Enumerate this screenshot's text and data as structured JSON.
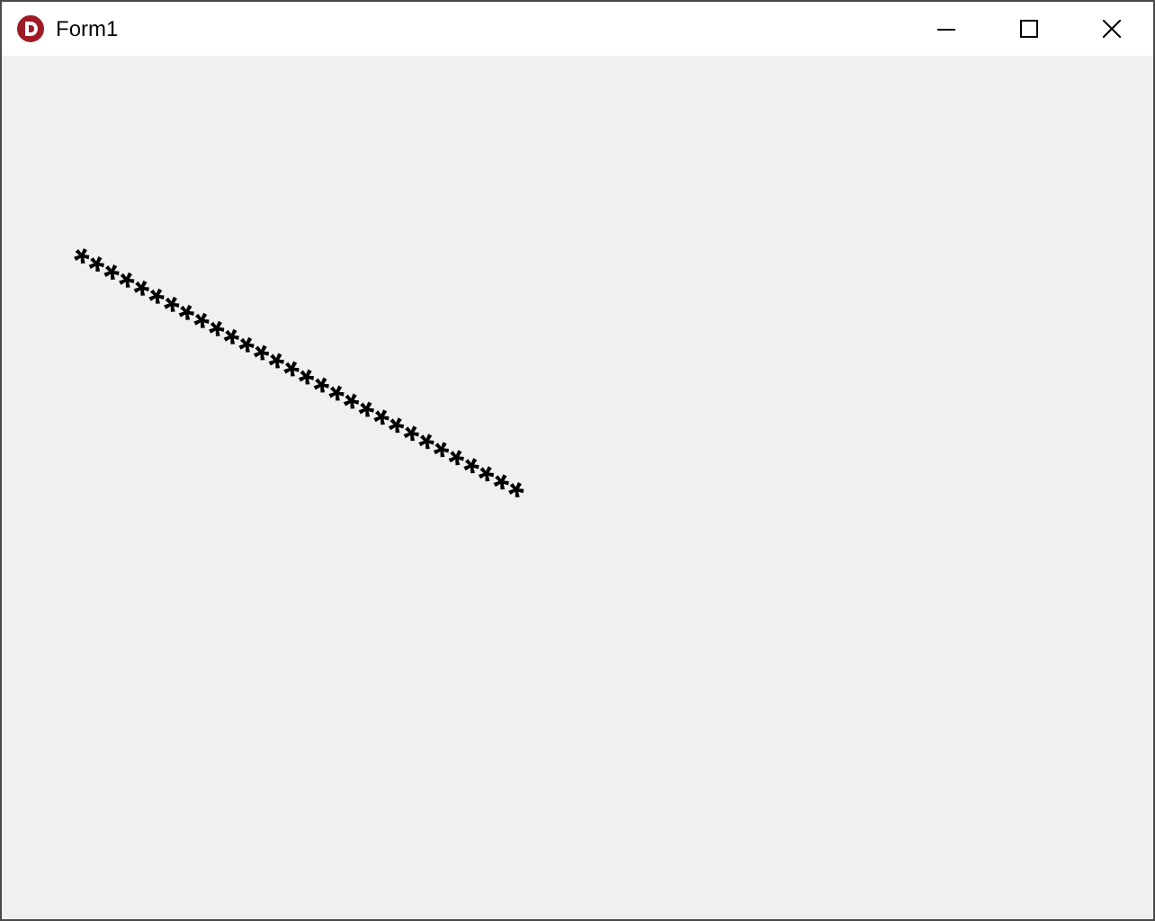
{
  "window": {
    "title": "Form1"
  },
  "rotated_text": "******************************"
}
